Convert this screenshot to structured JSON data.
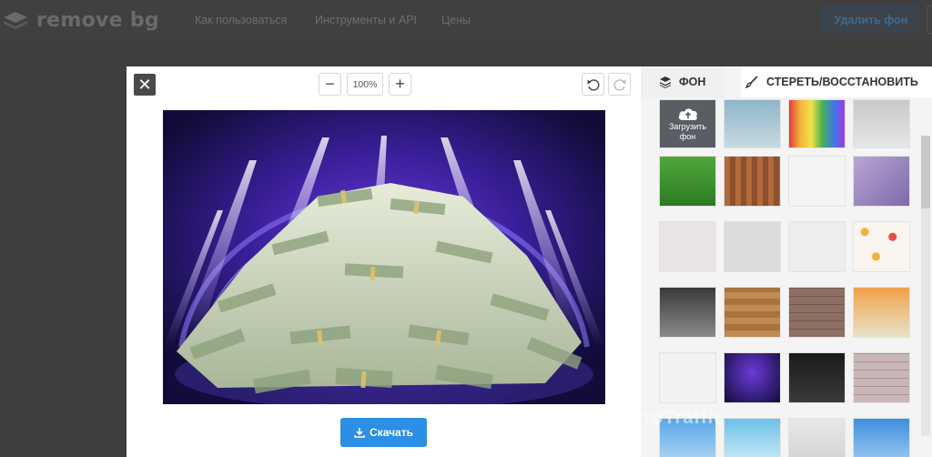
{
  "brand": {
    "name": "remove bg"
  },
  "nav": {
    "links": [
      "Как пользоваться",
      "Инструменты и API",
      "Цены"
    ],
    "remove_button": "Удалить фон"
  },
  "editor": {
    "close_glyph": "✕",
    "zoom_out_glyph": "−",
    "zoom_in_glyph": "+",
    "zoom_value": "100%",
    "download_label": "Скачать"
  },
  "panel": {
    "tab_background": "ФОН",
    "tab_erase": "СТЕРЕТЬ/ВОССТАНОВИТЬ",
    "upload_label_1": "Загрузить",
    "upload_label_2": "фон"
  },
  "watermark": "ProTraffic",
  "colors": {
    "accent": "#2d8ee6",
    "overlay": "#3e3e3e"
  }
}
